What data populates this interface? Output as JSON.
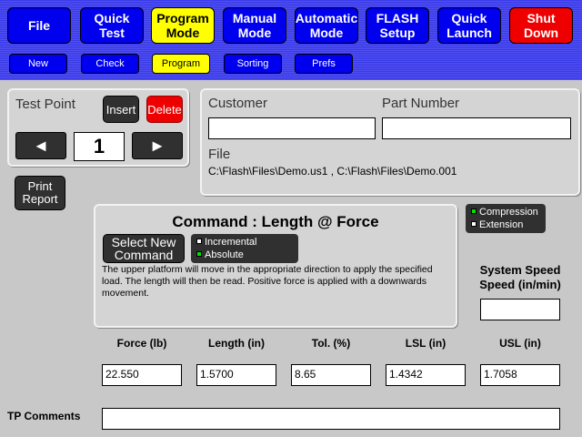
{
  "top_nav": {
    "file": "File",
    "quick_test": "Quick\nTest",
    "program_mode": "Program\nMode",
    "manual_mode": "Manual\nMode",
    "automatic_mode": "Automatic\nMode",
    "flash_setup": "FLASH\nSetup",
    "quick_launch": "Quick\nLaunch",
    "shut_down": "Shut\nDown"
  },
  "sub_nav": {
    "new": "New",
    "check": "Check",
    "program": "Program",
    "sorting": "Sorting",
    "prefs": "Prefs"
  },
  "test_point": {
    "title": "Test Point",
    "insert": "Insert",
    "delete": "Delete",
    "prev_glyph": "◄",
    "next_glyph": "►",
    "value": "1"
  },
  "print_report": "Print\nReport",
  "customer_panel": {
    "customer_label": "Customer",
    "customer_value": "",
    "part_label": "Part Number",
    "part_value": "",
    "file_label": "File",
    "file_value": "C:\\Flash\\Files\\Demo.us1 , C:\\Flash\\Files\\Demo.001"
  },
  "compression_legend": {
    "compression": "Compression",
    "extension": "Extension"
  },
  "command_panel": {
    "title": "Command : Length @ Force",
    "select_new": "Select New\nCommand",
    "incremental": "Incremental",
    "absolute": "Absolute",
    "description": "The upper platform will move in the appropriate direction to apply the specified load.  The length will then be read.  Positive force is applied with a downwards movement."
  },
  "system_speed": {
    "label": "System Speed\nSpeed (in/min)",
    "value": ""
  },
  "params": {
    "force_label": "Force (lb)",
    "force_value": "22.550",
    "length_label": "Length (in)",
    "length_value": "1.5700",
    "tol_label": "Tol. (%)",
    "tol_value": "8.65",
    "lsl_label": "LSL (in)",
    "lsl_value": "1.4342",
    "usl_label": "USL (in)",
    "usl_value": "1.7058"
  },
  "tp_comments": {
    "label": "TP Comments",
    "value": ""
  },
  "colors": {
    "nav_blue": "#0000ee",
    "active_yellow": "#ffff00",
    "shutdown_red": "#ee0000",
    "delete_red": "#ee0000",
    "indicator_green": "#00e000"
  }
}
